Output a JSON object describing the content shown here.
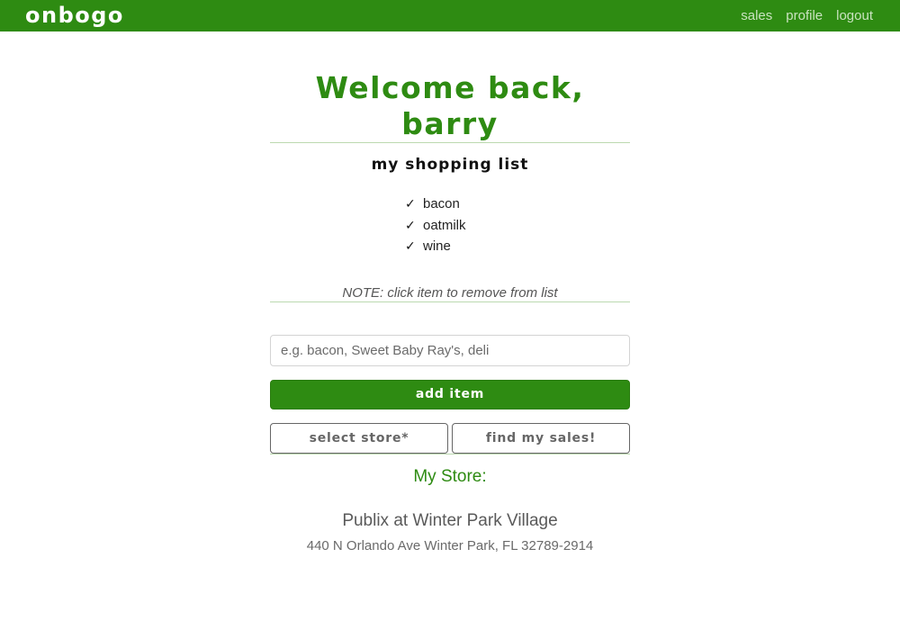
{
  "nav": {
    "brand": "onbogo",
    "links": [
      "sales",
      "profile",
      "logout"
    ]
  },
  "main": {
    "welcome": "Welcome back, barry",
    "list_title": "my shopping list",
    "check_glyph": "✓",
    "items": [
      "bacon",
      "oatmilk",
      "wine"
    ],
    "note": "NOTE: click item to remove from list"
  },
  "form": {
    "input_placeholder": "e.g. bacon, Sweet Baby Ray's, deli",
    "input_value": "",
    "add_button": "add item",
    "select_store_button": "select store*",
    "find_sales_button": "find my sales!"
  },
  "store": {
    "heading": "My Store:",
    "name": "Publix at Winter Park Village",
    "address": "440 N Orlando Ave Winter Park, FL 32789-2914"
  },
  "colors": {
    "brand_green": "#2e8b12",
    "nav_link": "#c9e3bf",
    "divider": "#bcd9b0",
    "outline_button": "#666666"
  }
}
